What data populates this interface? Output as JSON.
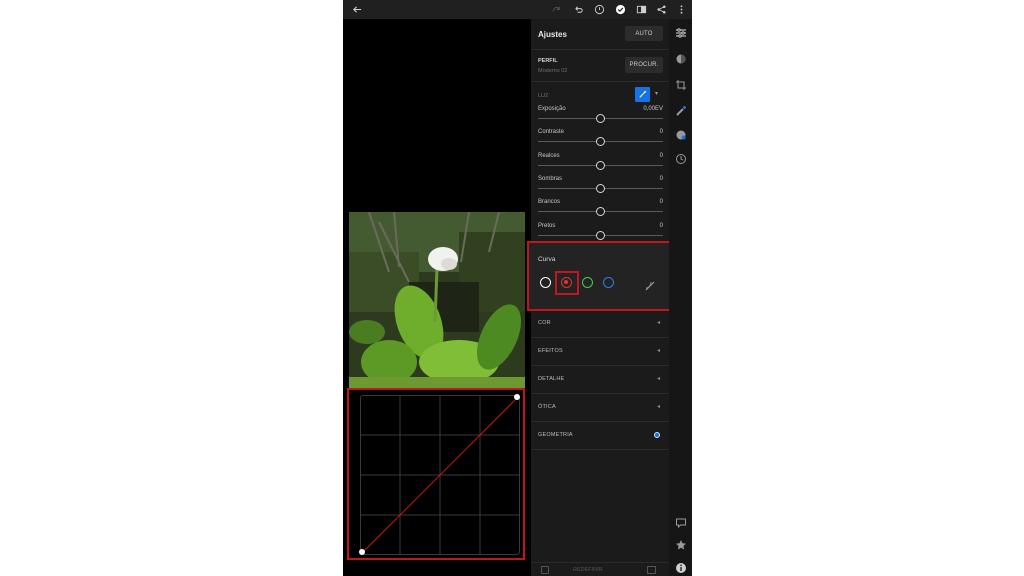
{
  "topbar": {
    "icons": [
      "back-arrow-icon",
      "redo-icon",
      "undo-icon",
      "help-icon",
      "checkmark-icon",
      "compare-icon",
      "share-icon",
      "more-icon"
    ]
  },
  "panel": {
    "title": "Ajustes",
    "auto_label": "AUTO",
    "profile": {
      "label": "PERFIL",
      "value": "Moderno 02",
      "browse_label": "PROCUR."
    },
    "light": {
      "label": "LUZ",
      "sliders": [
        {
          "label": "Exposição",
          "value": "0,00EV",
          "position": 0.5
        },
        {
          "label": "Contraste",
          "value": "0",
          "position": 0.5
        },
        {
          "label": "Realces",
          "value": "0",
          "position": 0.5
        },
        {
          "label": "Sombras",
          "value": "0",
          "position": 0.5
        },
        {
          "label": "Brancos",
          "value": "0",
          "position": 0.5
        },
        {
          "label": "Pretos",
          "value": "0",
          "position": 0.5
        }
      ]
    },
    "curve": {
      "title": "Curva",
      "channels": [
        "white",
        "red",
        "green",
        "blue"
      ],
      "selected_channel": "red"
    },
    "sections": [
      {
        "label": "COR"
      },
      {
        "label": "EFEITOS"
      },
      {
        "label": "DETALHE"
      },
      {
        "label": "ÓTICA"
      },
      {
        "label": "GEOMETRIA"
      }
    ],
    "bottom": {
      "reset_label": "REDEFINIR"
    }
  },
  "colors": {
    "accent": "#1473e6",
    "highlight_frame": "#c0161c",
    "red_channel": "#e0322f",
    "green_channel": "#3fcf4a",
    "blue_channel": "#2f7de0"
  }
}
